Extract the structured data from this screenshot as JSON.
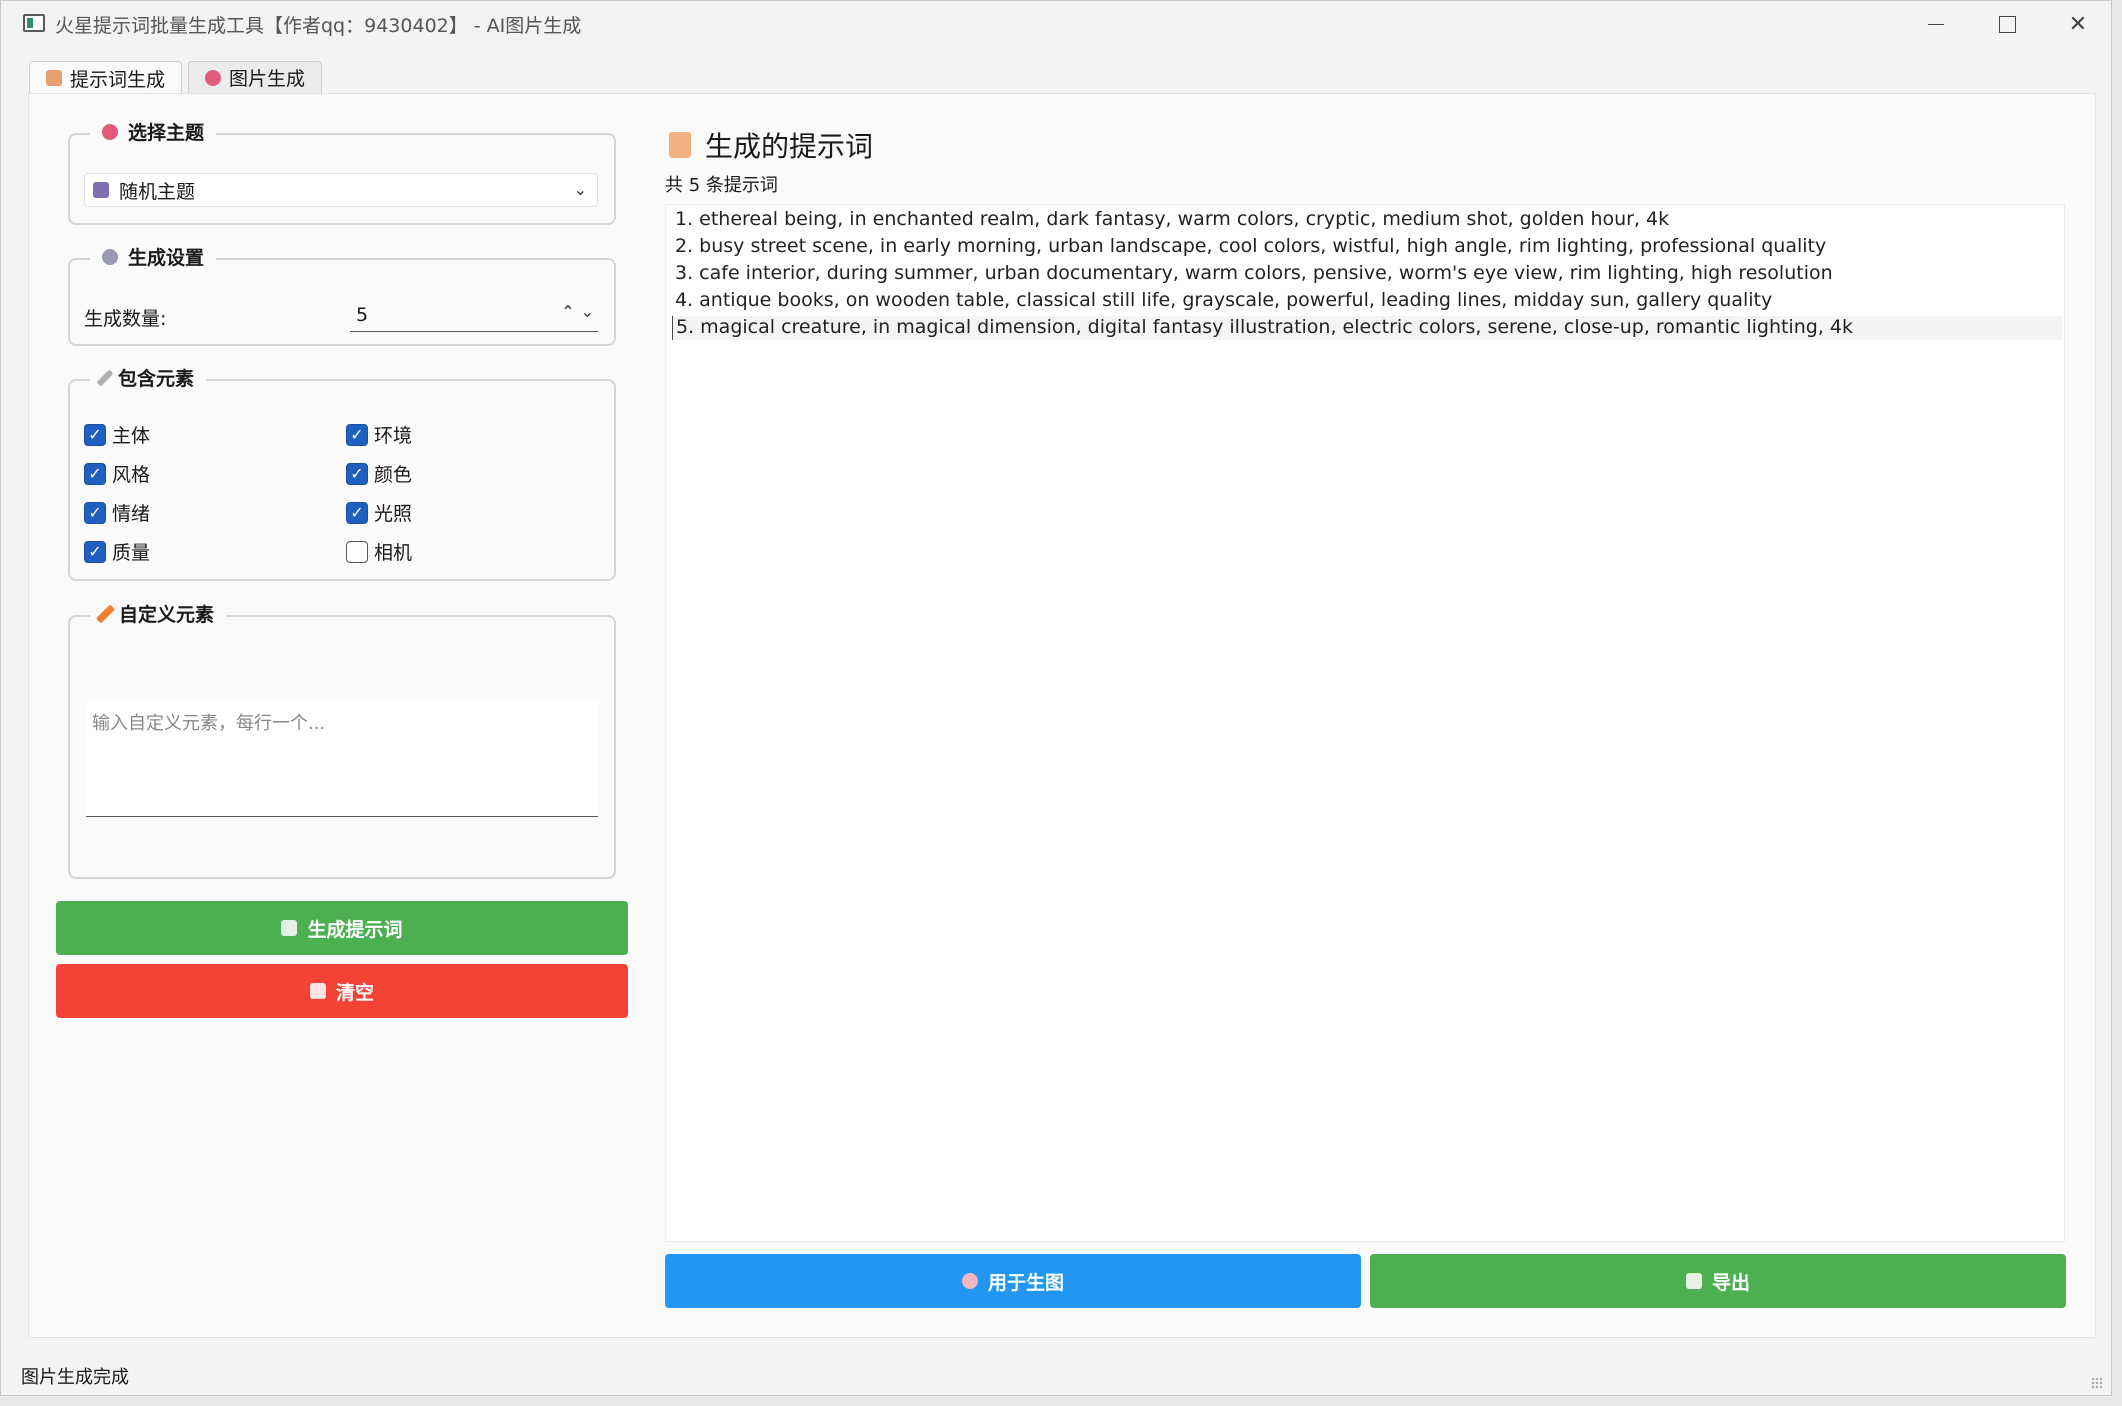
{
  "window": {
    "title": "火星提示词批量生成工具【作者qq：9430402】 - AI图片生成",
    "minimize": "",
    "maximize": "",
    "close": "✕"
  },
  "tabs": [
    {
      "label": "提示词生成",
      "icon": "note-icon",
      "active": true
    },
    {
      "label": "图片生成",
      "icon": "palette-icon",
      "active": false
    }
  ],
  "theme_group": {
    "title": "选择主题",
    "selected": "随机主题"
  },
  "settings_group": {
    "title": "生成设置",
    "count_label": "生成数量:",
    "count_value": "5"
  },
  "elements_group": {
    "title": "包含元素",
    "items": [
      {
        "label": "主体",
        "checked": true
      },
      {
        "label": "环境",
        "checked": true
      },
      {
        "label": "风格",
        "checked": true
      },
      {
        "label": "颜色",
        "checked": true
      },
      {
        "label": "情绪",
        "checked": true
      },
      {
        "label": "光照",
        "checked": true
      },
      {
        "label": "质量",
        "checked": true
      },
      {
        "label": "相机",
        "checked": false
      }
    ]
  },
  "custom_group": {
    "title": "自定义元素",
    "placeholder": "输入自定义元素，每行一个..."
  },
  "buttons": {
    "generate": "生成提示词",
    "clear": "清空",
    "use_for_image": "用于生图",
    "export": "导出"
  },
  "output": {
    "title": "生成的提示词",
    "count_text": "共 5 条提示词",
    "lines": [
      "1. ethereal being, in enchanted realm, dark fantasy, warm colors, cryptic, medium shot, golden hour, 4k",
      "2. busy street scene, in early morning, urban landscape, cool colors, wistful, high angle, rim lighting, professional quality",
      "3. cafe interior, during summer, urban documentary, warm colors, pensive, worm's eye view, rim lighting, high resolution",
      "4. antique books, on wooden table, classical still life, grayscale, powerful, leading lines, midday sun, gallery quality",
      "5. magical creature, in magical dimension, digital fantasy illustration, electric colors, serene, close-up, romantic lighting, 4k"
    ]
  },
  "status": "图片生成完成",
  "colors": {
    "green": "#4caf50",
    "red": "#f44336",
    "blue": "#2196f3",
    "checkbox": "#1f5fbf"
  }
}
